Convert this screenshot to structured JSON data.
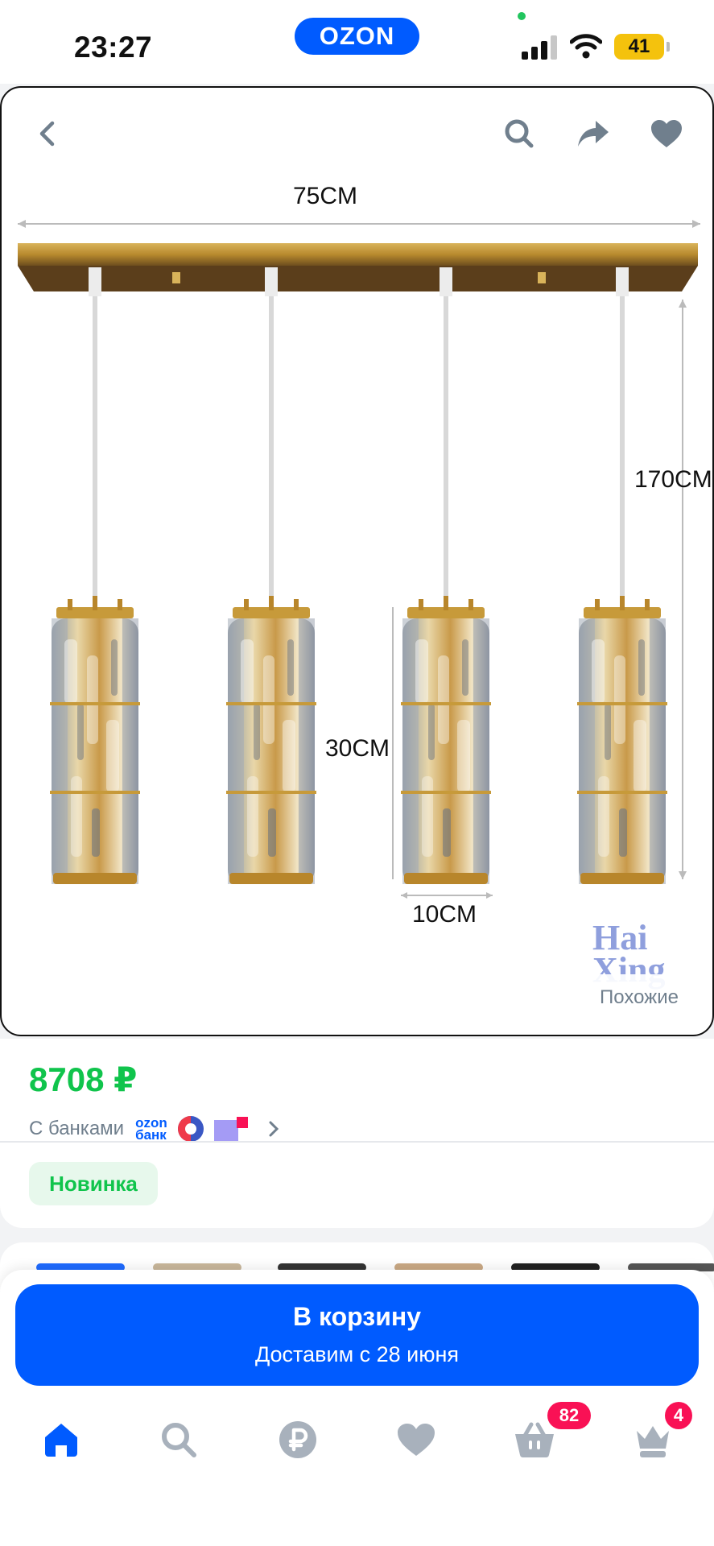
{
  "status_bar": {
    "time": "23:27",
    "app_badge": "OZON",
    "battery": "41"
  },
  "product_image": {
    "dimensions": {
      "width": "75CM",
      "height_total": "170CM",
      "shade_height": "30CM",
      "shade_width": "10CM"
    },
    "watermark": "Hai Xing",
    "similar_label": "Похожие"
  },
  "product": {
    "price": "8708 ₽",
    "banks_label": "С банками",
    "ozon_bank_logo": "ozon банк",
    "badge": "Новинка"
  },
  "cart": {
    "title": "В корзину",
    "delivery": "Доставим с 28 июня"
  },
  "nav": {
    "items": [
      {
        "name": "home",
        "icon": "home-icon",
        "badge": ""
      },
      {
        "name": "search",
        "icon": "search-icon",
        "badge": ""
      },
      {
        "name": "finance",
        "icon": "ruble-icon",
        "badge": ""
      },
      {
        "name": "favorites",
        "icon": "heart-icon",
        "badge": ""
      },
      {
        "name": "cart",
        "icon": "basket-icon",
        "badge": "82"
      },
      {
        "name": "profile",
        "icon": "crown-icon",
        "badge": "4"
      }
    ]
  },
  "colors": {
    "brand_blue": "#005bff",
    "price_green": "#10c44c",
    "badge_pink": "#f91155",
    "icon_grey": "#a8b1bc"
  }
}
